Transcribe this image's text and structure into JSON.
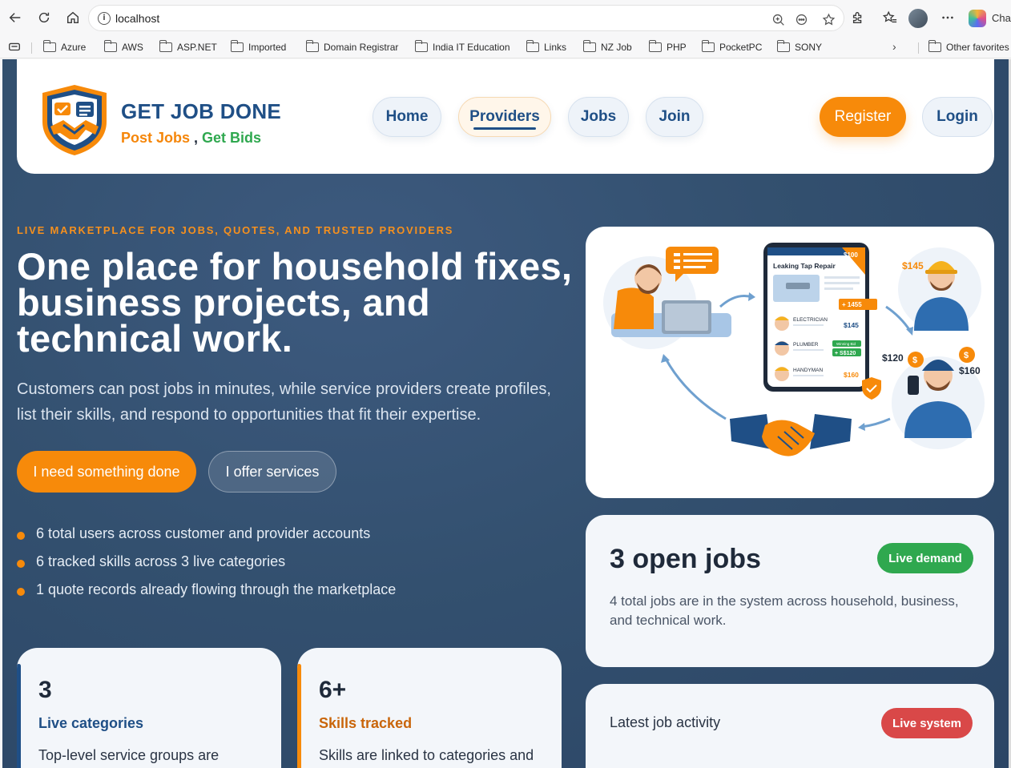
{
  "browser": {
    "address": "localhost",
    "chat_label": "Chat",
    "favorites": [
      "Azure",
      "AWS",
      "ASP.NET",
      "Imported",
      "Domain Registrar",
      "India IT Education",
      "Links",
      "NZ Job",
      "PHP",
      "PocketPC",
      "SONY"
    ],
    "other_favorites": "Other favorites"
  },
  "brand": {
    "title": "GET JOB DONE",
    "tag_post": "Post Jobs",
    "tag_sep": " , ",
    "tag_bids": "Get Bids",
    "colors": {
      "primary": "#1f4f86",
      "accent": "#f78a0a",
      "green": "#2fa84f"
    }
  },
  "nav": {
    "items": [
      "Home",
      "Providers",
      "Jobs",
      "Join"
    ],
    "active": "Providers",
    "register": "Register",
    "login": "Login"
  },
  "hero": {
    "eyebrow": "LIVE MARKETPLACE FOR JOBS, QUOTES, AND TRUSTED PROVIDERS",
    "title": "One place for household fixes, business projects, and technical work.",
    "subtitle": "Customers can post jobs in minutes, while service providers create profiles, list their skills, and respond to opportunities that fit their expertise.",
    "cta_primary": "I need something done",
    "cta_secondary": "I offer services",
    "bullets": [
      "6 total users across customer and provider accounts",
      "6 tracked skills across 3 live categories",
      "1 quote records already flowing through the marketplace"
    ]
  },
  "stats": [
    {
      "number": "3",
      "label": "Live categories",
      "desc": "Top-level service groups are"
    },
    {
      "number": "6+",
      "label": "Skills tracked",
      "desc": "Skills are linked to categories and"
    }
  ],
  "illustration": {
    "card_title": "Leaking Tap Repair",
    "card_price": "$100",
    "plus_badge": "+ 1455",
    "rows": [
      {
        "role": "ELECTRICIAN",
        "price": "$145"
      },
      {
        "role": "PLUMBER",
        "price": "+ S$120",
        "tag": "Winning Bid"
      },
      {
        "role": "HANDYMAN",
        "price": "$160"
      }
    ],
    "bubble_prices": [
      "$145",
      "$120",
      "$160"
    ]
  },
  "jobs_card": {
    "title": "3 open jobs",
    "badge": "Live demand",
    "desc": "4 total jobs are in the system across household, business, and technical work."
  },
  "activity_card": {
    "title": "Latest job activity",
    "badge": "Live system"
  }
}
